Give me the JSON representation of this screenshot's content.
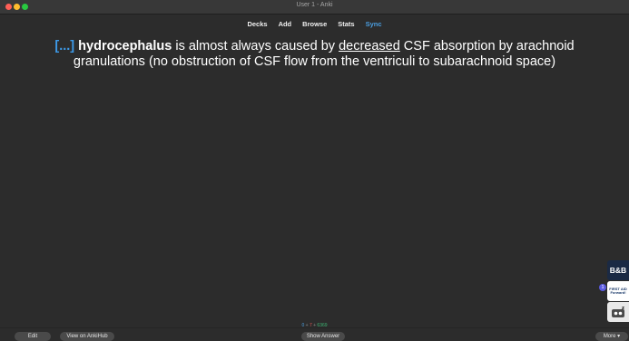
{
  "window": {
    "title": "User 1 - Anki"
  },
  "toolbar": {
    "items": [
      "Decks",
      "Add",
      "Browse",
      "Stats",
      "Sync"
    ]
  },
  "card": {
    "cloze": "[...]",
    "term": "hydrocephalus",
    "text_a": " is almost always caused by ",
    "underlined": "decreased",
    "text_b": " CSF absorption by arachnoid granulations (no obstruction of CSF flow from the ventriculi to subarachnoid space)"
  },
  "side": {
    "bb": "B&B",
    "fa_line1": "FIRST AID",
    "fa_line2": "Forward!",
    "badge": "1",
    "sketchy_icon": "sketchy-logo-icon"
  },
  "counts": {
    "new": "0",
    "sep1": " + ",
    "learn": "7",
    "sep2": " + ",
    "review": "6369"
  },
  "bottom": {
    "edit": "Edit",
    "ankihub": "View on AnkiHub",
    "show_answer": "Show Answer",
    "more": "More ▾"
  },
  "colors": {
    "accent": "#4a9ee0",
    "cloze": "#3d9ae8",
    "background": "#2c2c2c"
  }
}
